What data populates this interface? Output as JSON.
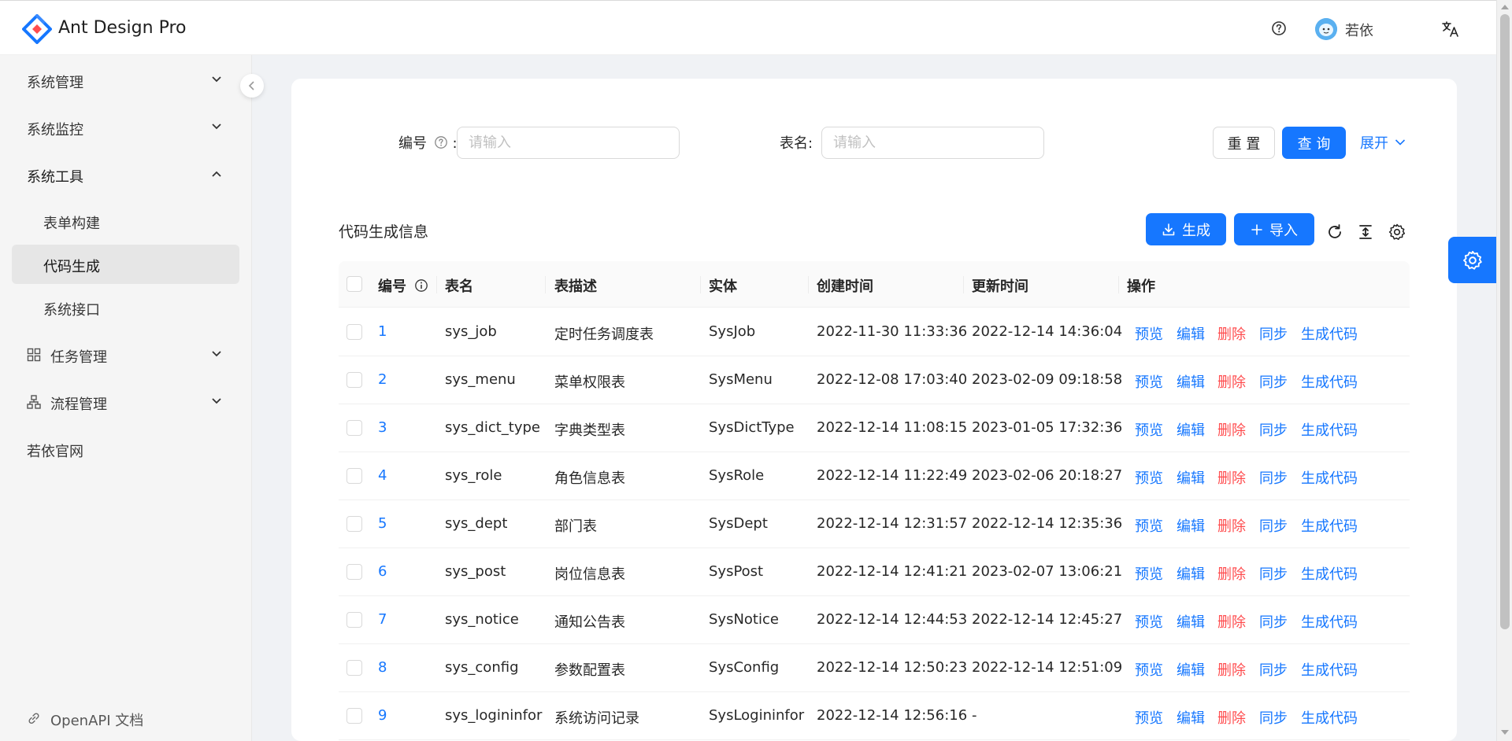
{
  "header": {
    "brand": "Ant Design Pro",
    "user_name": "若依",
    "icons": [
      "logo-icon",
      "question-circle-icon",
      "avatar",
      "translation-icon"
    ]
  },
  "sidebar": {
    "items": [
      {
        "label": "系统管理",
        "expanded": false
      },
      {
        "label": "系统监控",
        "expanded": false
      },
      {
        "label": "系统工具",
        "expanded": true
      },
      {
        "label": "表单构建"
      },
      {
        "label": "代码生成",
        "selected": true
      },
      {
        "label": "系统接口"
      },
      {
        "label": "任务管理",
        "icon": "appstore-icon",
        "expanded": false
      },
      {
        "label": "流程管理",
        "icon": "cluster-icon",
        "expanded": false
      },
      {
        "label": "若依官网"
      }
    ],
    "footer_link": "OpenAPI 文档"
  },
  "search": {
    "fields": [
      {
        "label": "编号",
        "colon": ":",
        "placeholder": "请输入",
        "value": ""
      },
      {
        "label": "表名",
        "colon": ":",
        "placeholder": "请输入",
        "value": ""
      }
    ],
    "reset_label": "重 置",
    "query_label": "查 询",
    "expand_label": "展开"
  },
  "toolbar": {
    "title": "代码生成信息",
    "generate_label": "生成",
    "import_label": "导入",
    "icons": [
      "reload-icon",
      "column-height-icon",
      "setting-icon"
    ]
  },
  "table": {
    "columns": [
      "编号",
      "表名",
      "表描述",
      "实体",
      "创建时间",
      "更新时间",
      "操作"
    ],
    "actions": [
      "预览",
      "编辑",
      "删除",
      "同步",
      "生成代码"
    ],
    "rows": [
      {
        "id": "1",
        "name": "sys_job",
        "desc": "定时任务调度表",
        "entity": "SysJob",
        "created": "2022-11-30 11:33:36",
        "updated": "2022-12-14 14:36:04"
      },
      {
        "id": "2",
        "name": "sys_menu",
        "desc": "菜单权限表",
        "entity": "SysMenu",
        "created": "2022-12-08 17:03:40",
        "updated": "2023-02-09 09:18:58"
      },
      {
        "id": "3",
        "name": "sys_dict_type",
        "desc": "字典类型表",
        "entity": "SysDictType",
        "created": "2022-12-14 11:08:15",
        "updated": "2023-01-05 17:32:36"
      },
      {
        "id": "4",
        "name": "sys_role",
        "desc": "角色信息表",
        "entity": "SysRole",
        "created": "2022-12-14 11:22:49",
        "updated": "2023-02-06 20:18:27"
      },
      {
        "id": "5",
        "name": "sys_dept",
        "desc": "部门表",
        "entity": "SysDept",
        "created": "2022-12-14 12:31:57",
        "updated": "2022-12-14 12:35:36"
      },
      {
        "id": "6",
        "name": "sys_post",
        "desc": "岗位信息表",
        "entity": "SysPost",
        "created": "2022-12-14 12:41:21",
        "updated": "2023-02-07 13:06:21"
      },
      {
        "id": "7",
        "name": "sys_notice",
        "desc": "通知公告表",
        "entity": "SysNotice",
        "created": "2022-12-14 12:44:53",
        "updated": "2022-12-14 12:45:27"
      },
      {
        "id": "8",
        "name": "sys_config",
        "desc": "参数配置表",
        "entity": "SysConfig",
        "created": "2022-12-14 12:50:23",
        "updated": "2022-12-14 12:51:09"
      },
      {
        "id": "9",
        "name": "sys_logininfor",
        "desc": "系统访问记录",
        "entity": "SysLogininfor",
        "created": "2022-12-14 12:56:16",
        "updated": "-"
      }
    ]
  },
  "colors": {
    "primary": "#1677ff",
    "danger": "#ff4d4f"
  }
}
